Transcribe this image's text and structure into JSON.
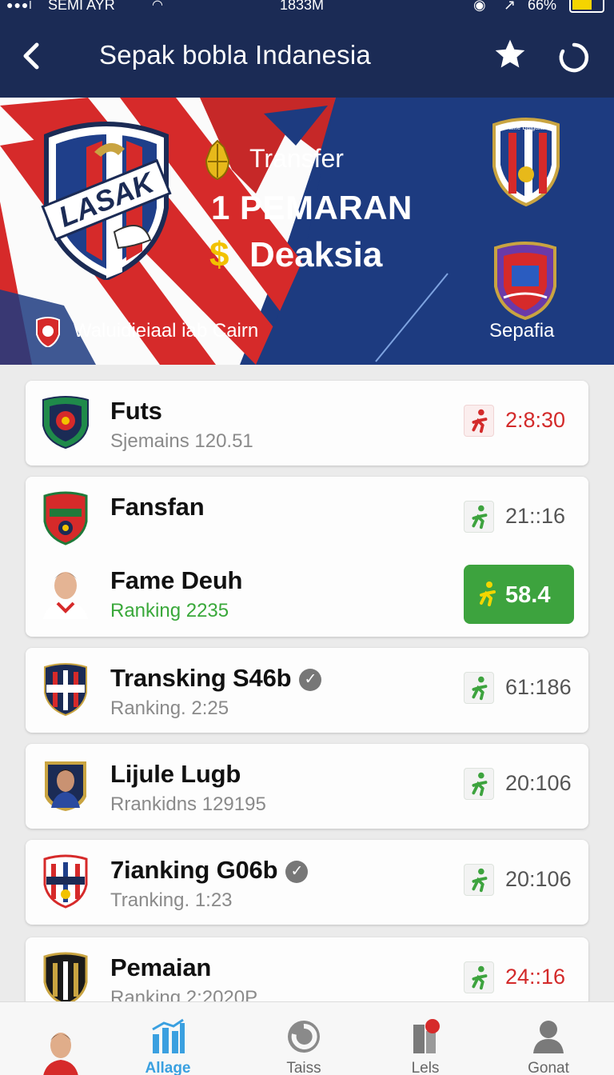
{
  "status_bar": {
    "signal": "●●●l",
    "carrier": "SEMI AYR",
    "time": "1833M",
    "battery_pct": "66%",
    "battery_level": 0.66
  },
  "header": {
    "title": "Sepak bobla Indanesia",
    "back_icon": "chevron-left-icon",
    "fav_icon": "star-icon",
    "refresh_icon": "refresh-icon"
  },
  "banner": {
    "crest_text": "LASAK",
    "transfer_label": "Transfer",
    "headline": "1 PEMARAN",
    "dollar": "$",
    "sub": "Deaksia",
    "top_crest_text": "Falfle Balgalan",
    "right_label": "Sepafia",
    "caption": "Waluidieiaal iab Cairn",
    "colors": {
      "navy": "#1b2b55",
      "blue": "#1a3f8a",
      "red": "#d62a2a",
      "gold": "#f2c200"
    }
  },
  "list": {
    "rows": [
      {
        "name": "Futs",
        "sub": "Sjemains 120.51",
        "value": "2:8:30",
        "value_color": "red",
        "verified": false
      },
      {
        "name": "Fansfan",
        "sub": "",
        "value": "21::16",
        "value_color": "gray",
        "verified": false
      },
      {
        "name": "Fame Deuh",
        "sub": "Ranking 2235",
        "value": "58.4",
        "value_color": "pill",
        "verified": false,
        "sub_color": "green"
      },
      {
        "name": "Transking S46b",
        "sub": "Ranking. 2:25",
        "value": "61:186",
        "value_color": "gray",
        "verified": true
      },
      {
        "name": "Lijule Lugb",
        "sub": "Rrankidns 129195",
        "value": "20:106",
        "value_color": "gray",
        "verified": false
      },
      {
        "name": "7ianking G06b",
        "sub": "Tranking. 1:23",
        "value": "20:106",
        "value_color": "gray",
        "verified": true
      },
      {
        "name": "Pemaian",
        "sub": "Ranking 2:2020P",
        "value": "24::16",
        "value_color": "red",
        "verified": false
      }
    ]
  },
  "bottom_nav": {
    "items": [
      {
        "label": "Allage",
        "icon": "chart-icon",
        "active": true
      },
      {
        "label": "Taiss",
        "icon": "refresh-icon",
        "active": false
      },
      {
        "label": "Lels",
        "icon": "pin-icon",
        "active": false
      },
      {
        "label": "Gonat",
        "icon": "person-icon",
        "active": false
      }
    ]
  }
}
